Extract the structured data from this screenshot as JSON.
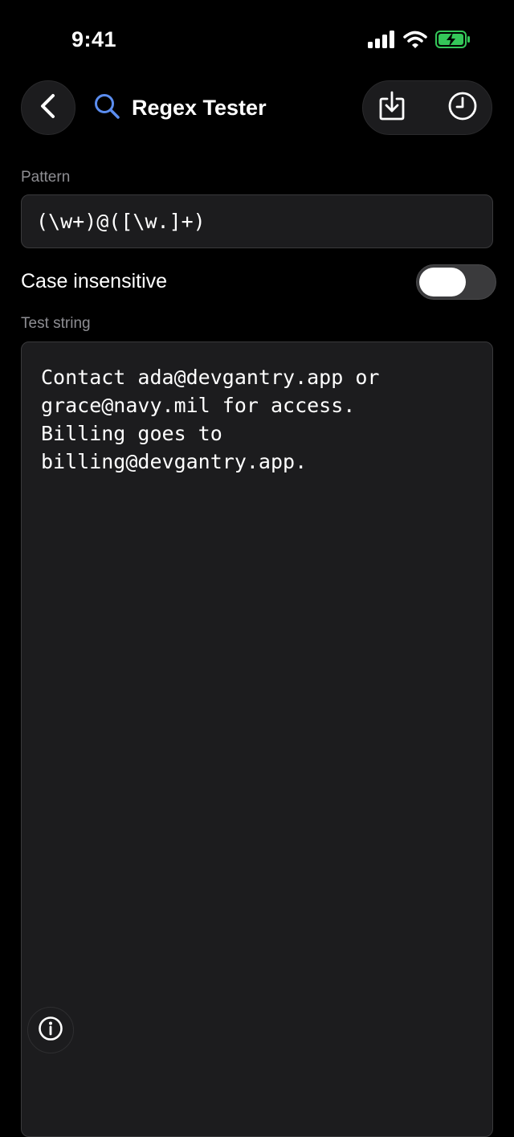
{
  "status_bar": {
    "time": "9:41",
    "icons": [
      "cellular-signal-icon",
      "wifi-icon",
      "battery-charging-icon"
    ],
    "battery_color": "#34c759"
  },
  "header": {
    "back_icon": "chevron-left-icon",
    "search_icon": "search-icon",
    "search_icon_color": "#5b8def",
    "title": "Regex Tester",
    "actions": [
      {
        "icon": "download-icon"
      },
      {
        "icon": "history-clock-icon"
      }
    ]
  },
  "pattern": {
    "label": "Pattern",
    "value": "(\\w+)@([\\w.]+)"
  },
  "options": {
    "case_insensitive_label": "Case insensitive",
    "case_insensitive_enabled": false
  },
  "test_string": {
    "label": "Test string",
    "value": "Contact ada@devgantry.app or\ngrace@navy.mil for access.\nBilling goes to\nbilling@devgantry.app."
  },
  "info_button": {
    "icon": "info-icon"
  },
  "colors": {
    "background": "#000000",
    "surface": "#1c1c1e",
    "label": "#8e8e93"
  }
}
